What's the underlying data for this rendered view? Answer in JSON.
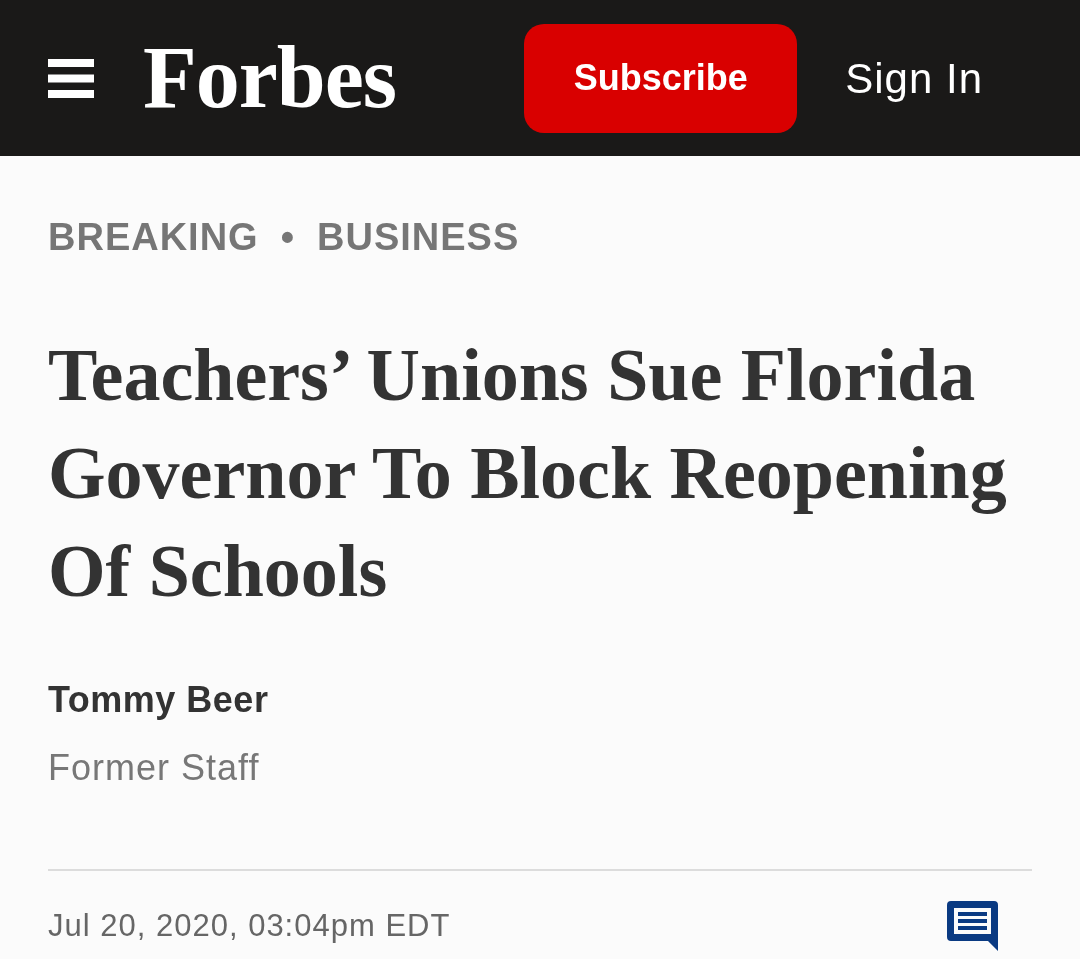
{
  "header": {
    "logo": "Forbes",
    "subscribe_button": "Subscribe",
    "sign_in_link": "Sign In"
  },
  "article": {
    "breadcrumbs": [
      {
        "label": "BREAKING"
      },
      {
        "label": "BUSINESS"
      }
    ],
    "separator": "•",
    "headline": "Teachers’ Unions Sue Florida Governor To Block Reopening Of Schools",
    "author": {
      "name": "Tommy Beer",
      "role": "Former Staff"
    },
    "timestamp": "Jul 20, 2020, 03:04pm EDT"
  }
}
